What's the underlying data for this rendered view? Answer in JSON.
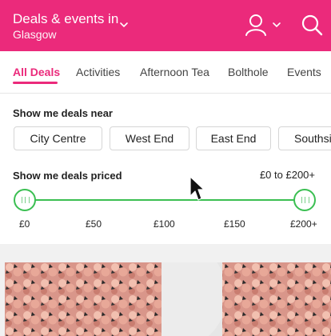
{
  "header": {
    "title": "Deals & events in",
    "location": "Glasgow",
    "icons": [
      "chevron-down-icon",
      "user-icon",
      "search-icon"
    ]
  },
  "tabs": [
    {
      "label": "All Deals",
      "active": true
    },
    {
      "label": "Activities",
      "active": false
    },
    {
      "label": "Afternoon Tea",
      "active": false
    },
    {
      "label": "Bolthole",
      "active": false
    },
    {
      "label": "Events",
      "active": false
    }
  ],
  "near": {
    "label": "Show me deals near",
    "chips": [
      "City Centre",
      "West End",
      "East End",
      "Southsi"
    ]
  },
  "price": {
    "label": "Show me deals priced",
    "range_text": "£0 to £200+",
    "min": 0,
    "max": 200,
    "selected_min": 0,
    "selected_max": 200,
    "ticks": [
      "£0",
      "£50",
      "£100",
      "£150",
      "£200+"
    ]
  },
  "colors": {
    "brand": "#eb2a7b",
    "slider": "#3bbf52"
  }
}
